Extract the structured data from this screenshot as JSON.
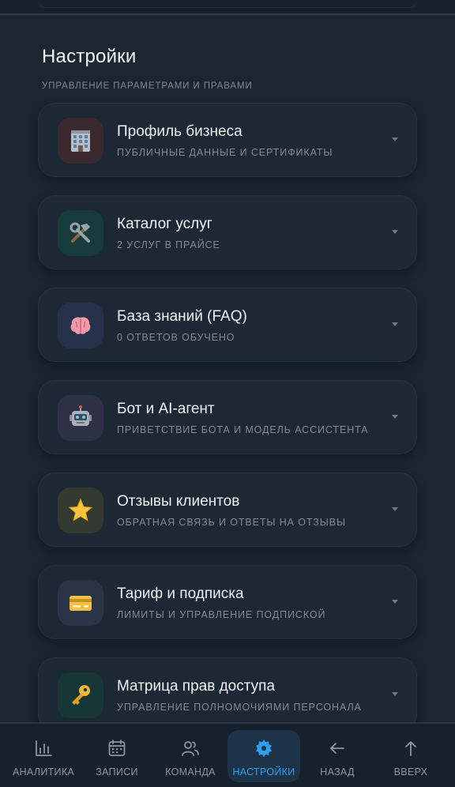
{
  "header": {
    "title": "Настройки",
    "subtitle": "УПРАВЛЕНИЕ ПАРАМЕТРАМИ И ПРАВАМИ"
  },
  "sections": [
    {
      "title": "Профиль бизнеса",
      "subtitle": "ПУБЛИЧНЫЕ ДАННЫЕ И СЕРТИФИКАТЫ",
      "icon": "office-building-icon",
      "tile_color": "#3a2a30"
    },
    {
      "title": "Каталог услуг",
      "subtitle": "2 УСЛУГ В ПРАЙСЕ",
      "icon": "hammer-wrench-icon",
      "tile_color": "#173a3a"
    },
    {
      "title": "База знаний (FAQ)",
      "subtitle": "0 ОТВЕТОВ ОБУЧЕНО",
      "icon": "brain-icon",
      "tile_color": "#25324a"
    },
    {
      "title": "Бот и AI-агент",
      "subtitle": "ПРИВЕТСТВИЕ БОТА И МОДЕЛЬ АССИСТЕНТА",
      "icon": "robot-icon",
      "tile_color": "#2e3048"
    },
    {
      "title": "Отзывы клиентов",
      "subtitle": "ОБРАТНАЯ СВЯЗЬ И ОТВЕТЫ НА ОТЗЫВЫ",
      "icon": "star-icon",
      "tile_color": "#333a30"
    },
    {
      "title": "Тариф и подписка",
      "subtitle": "ЛИМИТЫ И УПРАВЛЕНИЕ ПОДПИСКОЙ",
      "icon": "credit-card-icon",
      "tile_color": "#2a3446"
    },
    {
      "title": "Матрица прав доступа",
      "subtitle": "УПРАВЛЕНИЕ ПОЛНОМОЧИЯМИ ПЕРСОНАЛА",
      "icon": "key-icon",
      "tile_color": "#153836"
    }
  ],
  "nav": [
    {
      "label": "АНАЛИТИКА",
      "icon": "bar-chart-icon"
    },
    {
      "label": "ЗАПИСИ",
      "icon": "calendar-icon"
    },
    {
      "label": "КОМАНДА",
      "icon": "users-icon"
    },
    {
      "label": "НАСТРОЙКИ",
      "icon": "gear-icon",
      "active": true
    },
    {
      "label": "НАЗАД",
      "icon": "arrow-left-icon"
    },
    {
      "label": "ВВЕРХ",
      "icon": "arrow-up-icon"
    }
  ],
  "colors": {
    "background": "#1b2631",
    "accent": "#2f9ff0"
  }
}
